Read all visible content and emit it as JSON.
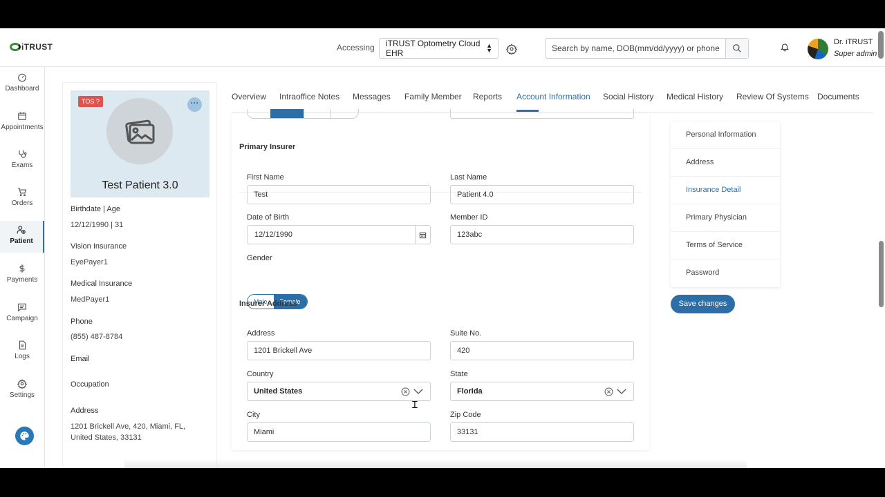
{
  "header": {
    "logo_text": "iTRUST",
    "accessing_label": "Accessing",
    "ehr_selected": "iTRUST Optometry Cloud EHR",
    "search_placeholder": "Search by name, DOB(mm/dd/yyyy) or phone",
    "user_name": "Dr. iTRUST",
    "user_role": "Super admin"
  },
  "sidebar": {
    "items": [
      {
        "label": "Dashboard",
        "icon": "dashboard-icon"
      },
      {
        "label": "Appointments",
        "icon": "calendar-icon"
      },
      {
        "label": "Exams",
        "icon": "stethoscope-icon"
      },
      {
        "label": "Orders",
        "icon": "cart-icon"
      },
      {
        "label": "Patient",
        "icon": "patient-icon",
        "active": true
      },
      {
        "label": "Payments",
        "icon": "dollar-icon"
      },
      {
        "label": "Campaign",
        "icon": "message-icon"
      },
      {
        "label": "Logs",
        "icon": "document-icon"
      },
      {
        "label": "Settings",
        "icon": "gear-icon"
      }
    ]
  },
  "patient": {
    "tos_badge": "TOS ?",
    "more": "···",
    "name": "Test Patient 3.0",
    "fields": [
      {
        "label": "Birthdate | Age",
        "value": "12/12/1990 | 31"
      },
      {
        "label": "Vision Insurance",
        "value": "EyePayer1"
      },
      {
        "label": "Medical Insurance",
        "value": "MedPayer1"
      },
      {
        "label": "Phone",
        "value": "(855) 487-8784"
      },
      {
        "label": "Email",
        "value": ""
      },
      {
        "label": "Occupation",
        "value": ""
      },
      {
        "label": "Address",
        "value": "1201 Brickell Ave, 420, Miami, FL, United States, 33131"
      }
    ]
  },
  "tabs": [
    "Overview",
    "Intraoffice Notes",
    "Messages",
    "Family Member",
    "Reports",
    "Account Information",
    "Social History",
    "Medical History",
    "Review Of Systems",
    "Documents"
  ],
  "active_tab": "Account Information",
  "form": {
    "primary_insurer_title": "Primary Insurer",
    "first_name_label": "First Name",
    "first_name": "Test",
    "last_name_label": "Last Name",
    "last_name": "Patient 4.0",
    "dob_label": "Date of Birth",
    "dob": "12/12/1990",
    "member_id_label": "Member ID",
    "member_id": "123abc",
    "gender_label": "Gender",
    "gender_options": [
      "Male",
      "Female"
    ],
    "gender_selected": "Female",
    "insurer_address_title": "Insurer Address",
    "address_label": "Address",
    "address": "1201 Brickell Ave",
    "suite_label": "Suite No.",
    "suite": "420",
    "country_label": "Country",
    "country": "United States",
    "state_label": "State",
    "state": "Florida",
    "city_label": "City",
    "city": "Miami",
    "zip_label": "Zip Code",
    "zip": "33131"
  },
  "settings_menu": {
    "items": [
      "Personal Information",
      "Address",
      "Insurance Detail",
      "Primary Physician",
      "Terms of Service",
      "Password"
    ],
    "active": "Insurance Detail",
    "save_label": "Save changes"
  },
  "colors": {
    "accent": "#2c6ea5",
    "tos": "#e0534e",
    "card_header": "#dde9f1"
  }
}
